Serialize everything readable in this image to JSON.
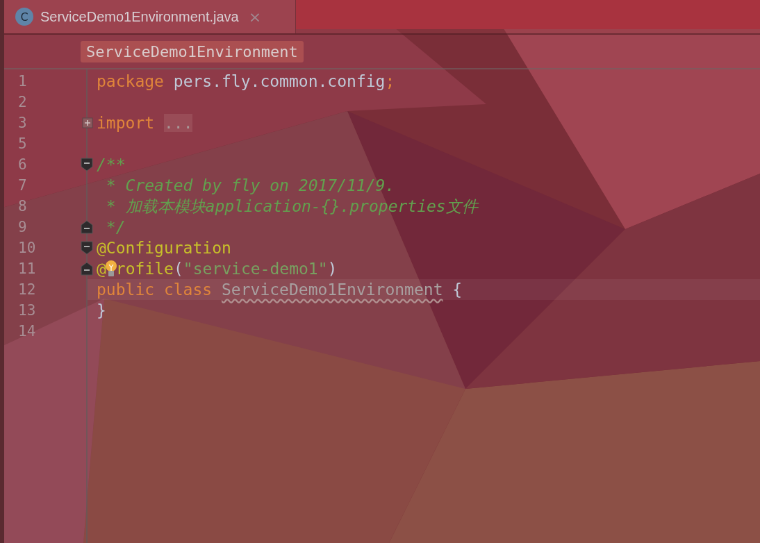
{
  "tab": {
    "icon_letter": "C",
    "title": "ServiceDemo1Environment.java",
    "close": "×",
    "selected": true
  },
  "breadcrumb": "ServiceDemo1Environment",
  "lines": [
    {
      "number": "1",
      "current": false,
      "tokens": [
        {
          "kind": "keyword",
          "text": "package "
        },
        {
          "kind": "plain",
          "text": "pers.fly.common.config"
        },
        {
          "kind": "keyword",
          "text": ";"
        }
      ]
    },
    {
      "number": "2",
      "current": false
    },
    {
      "number": "3",
      "fold": {
        "kind": "expand"
      },
      "current": false,
      "tokens": [
        {
          "kind": "keyword",
          "text": "import "
        },
        {
          "kind": "folded",
          "text": "..."
        }
      ]
    },
    {
      "number": "5",
      "current": false
    },
    {
      "number": "6",
      "fold": {
        "kind": "start"
      },
      "current": false,
      "tokens": [
        {
          "kind": "comment",
          "text": "/**"
        }
      ]
    },
    {
      "number": "7",
      "current": false,
      "tokens": [
        {
          "kind": "comment",
          "text": " * Created by fly on 2017/11/9."
        }
      ]
    },
    {
      "number": "8",
      "current": false,
      "tokens": [
        {
          "kind": "comment",
          "text": " * 加载本模块application-{}.properties文件"
        }
      ]
    },
    {
      "number": "9",
      "fold": {
        "kind": "end"
      },
      "current": false,
      "tokens": [
        {
          "kind": "comment",
          "text": " */"
        }
      ]
    },
    {
      "number": "10",
      "fold": {
        "kind": "start"
      },
      "current": false,
      "tokens": [
        {
          "kind": "annotation",
          "text": "@Configuration"
        }
      ]
    },
    {
      "number": "11",
      "fold": {
        "kind": "end"
      },
      "current": false,
      "tokens": [
        {
          "kind": "annotation",
          "text": "@"
        },
        {
          "kind": "bulb"
        },
        {
          "kind": "annotation",
          "text": "rofile"
        },
        {
          "kind": "plain",
          "text": "("
        },
        {
          "kind": "string",
          "text": "\"service-demo1\""
        },
        {
          "kind": "plain",
          "text": ")"
        }
      ]
    },
    {
      "number": "12",
      "current": true,
      "tokens": [
        {
          "kind": "keyword",
          "text": "public class "
        },
        {
          "kind": "classname",
          "text": "ServiceDemo1Environment"
        },
        {
          "kind": "plain",
          "text": " {"
        }
      ]
    },
    {
      "number": "13",
      "current": false,
      "tokens": [
        {
          "kind": "plain",
          "text": "}"
        }
      ]
    },
    {
      "number": "14",
      "current": false
    }
  ]
}
